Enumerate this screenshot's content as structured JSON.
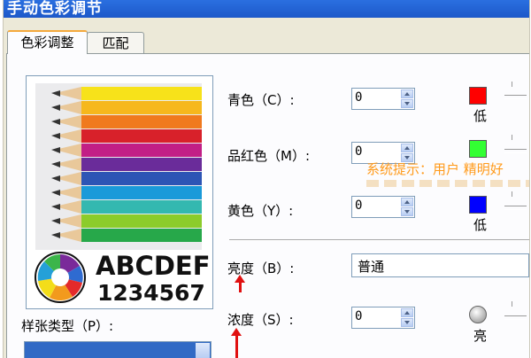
{
  "window": {
    "title": "手动色彩调节"
  },
  "tabs": [
    {
      "label": "色彩调整"
    },
    {
      "label": "匹配"
    }
  ],
  "preview": {
    "line1": "ABCDEF",
    "line2": "1234567"
  },
  "paper_type": {
    "label": "样张类型（P）:"
  },
  "controls": {
    "cyan": {
      "label": "青色（C）:",
      "value": "0",
      "swatch_color": "#ff0000",
      "scale_label": "低"
    },
    "magenta": {
      "label": "品红色（M）:",
      "value": "0",
      "swatch_color": "#33ff33",
      "scale_label": ""
    },
    "yellow": {
      "label": "黄色（Y）:",
      "value": "0",
      "swatch_color": "#0000ff",
      "scale_label": "低"
    },
    "brightness": {
      "label": "亮度（B）:",
      "value": "普通"
    },
    "density": {
      "label": "浓度（S）:",
      "value": "0",
      "scale_label": "亮"
    }
  },
  "system_tip": {
    "text": "系统提示：用户 精明好"
  }
}
